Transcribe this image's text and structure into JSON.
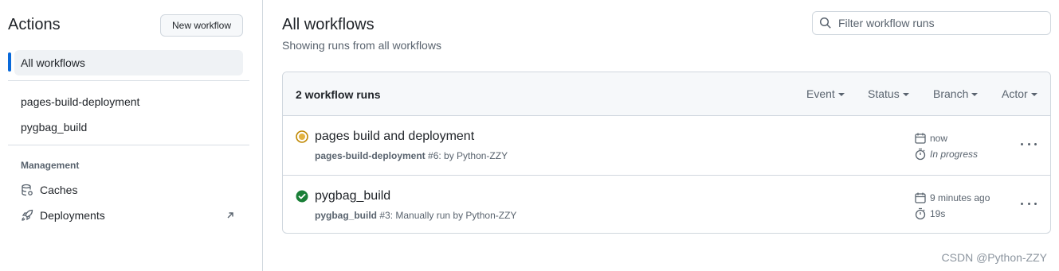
{
  "sidebar": {
    "title": "Actions",
    "new_workflow_label": "New workflow",
    "all_workflows_label": "All workflows",
    "workflows": [
      "pages-build-deployment",
      "pygbag_build"
    ],
    "management_label": "Management",
    "management_items": [
      "Caches",
      "Deployments"
    ]
  },
  "main": {
    "title": "All workflows",
    "subtitle": "Showing runs from all workflows",
    "filter_placeholder": "Filter workflow runs",
    "runs_count": "2 workflow runs",
    "filters": [
      "Event",
      "Status",
      "Branch",
      "Actor"
    ],
    "runs": [
      {
        "title": "pages build and deployment",
        "workflow": "pages-build-deployment",
        "detail": "#6: by Python-ZZY",
        "status": "in-progress",
        "when": "now",
        "duration": "In progress"
      },
      {
        "title": "pygbag_build",
        "workflow": "pygbag_build",
        "detail": "#3: Manually run by Python-ZZY",
        "status": "success",
        "when": "9 minutes ago",
        "duration": "19s"
      }
    ]
  },
  "watermark": "CSDN @Python-ZZY",
  "colors": {
    "accent": "#0969da",
    "success": "#1a7f37",
    "in_progress": "#bf8700"
  }
}
